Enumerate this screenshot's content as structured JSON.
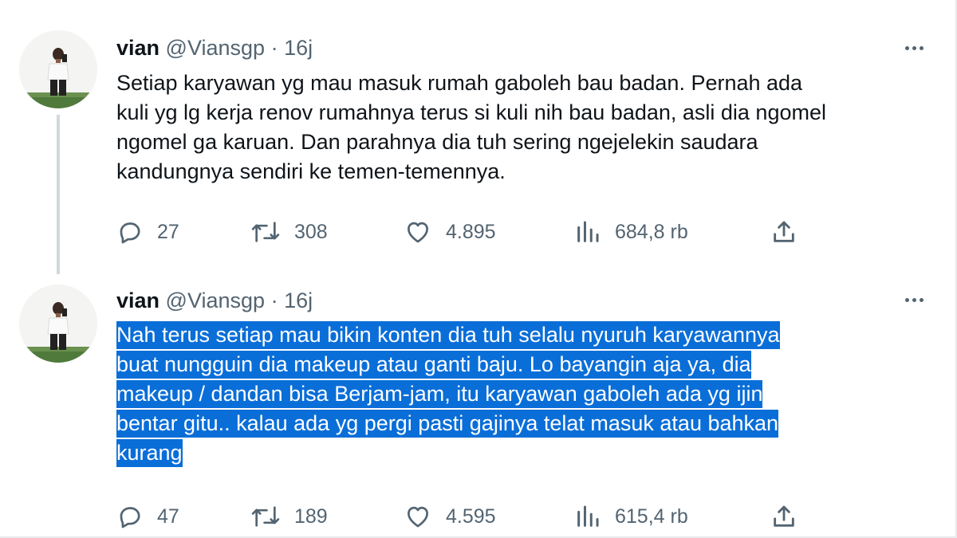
{
  "tweets": [
    {
      "name": "vian",
      "handle": "@Viansgp",
      "separator": "·",
      "time": "16j",
      "text_lines": [
        "Setiap karyawan yg mau masuk rumah gaboleh bau badan. Pernah ada",
        "kuli yg lg kerja renov rumahnya terus si kuli nih bau badan, asli dia ngomel",
        "ngomel ga karuan. Dan parahnya dia tuh sering ngejelekin saudara",
        "kandungnya sendiri ke temen-temennya."
      ],
      "highlighted": false,
      "stats": {
        "replies": "27",
        "retweets": "308",
        "likes": "4.895",
        "views": "684,8 rb"
      }
    },
    {
      "name": "vian",
      "handle": "@Viansgp",
      "separator": "·",
      "time": "16j",
      "text_lines": [
        "Nah terus setiap mau bikin konten dia tuh selalu nyuruh karyawannya",
        "buat nungguin dia makeup atau ganti baju. Lo bayangin aja ya, dia",
        "makeup / dandan bisa Berjam-jam, itu karyawan gaboleh ada yg ijin",
        "bentar gitu.. kalau ada yg pergi pasti gajinya telat masuk atau bahkan",
        "kurang"
      ],
      "highlighted": true,
      "stats": {
        "replies": "47",
        "retweets": "189",
        "likes": "4.595",
        "views": "615,4 rb"
      }
    }
  ],
  "colors": {
    "text": "#0f1419",
    "secondary": "#536471",
    "selection": "#0a6ed8",
    "thread_line": "#cfd9de"
  },
  "icons": [
    "reply-icon",
    "retweet-icon",
    "like-icon",
    "views-icon",
    "share-icon",
    "more-icon"
  ]
}
